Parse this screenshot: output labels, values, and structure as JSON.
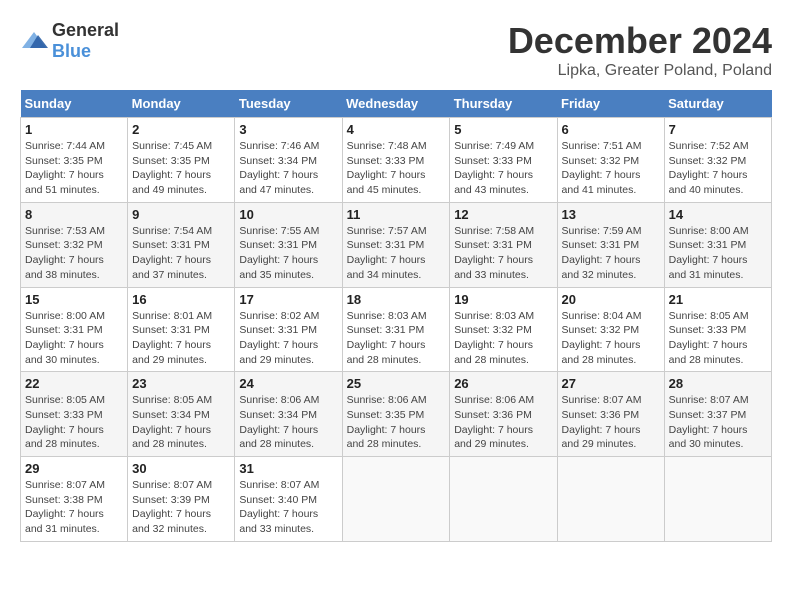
{
  "header": {
    "logo": {
      "text_general": "General",
      "text_blue": "Blue"
    },
    "title": "December 2024",
    "subtitle": "Lipka, Greater Poland, Poland"
  },
  "calendar": {
    "columns": [
      "Sunday",
      "Monday",
      "Tuesday",
      "Wednesday",
      "Thursday",
      "Friday",
      "Saturday"
    ],
    "weeks": [
      [
        null,
        {
          "day": "2",
          "sunrise": "Sunrise: 7:45 AM",
          "sunset": "Sunset: 3:35 PM",
          "daylight": "Daylight: 7 hours and 49 minutes."
        },
        {
          "day": "3",
          "sunrise": "Sunrise: 7:46 AM",
          "sunset": "Sunset: 3:34 PM",
          "daylight": "Daylight: 7 hours and 47 minutes."
        },
        {
          "day": "4",
          "sunrise": "Sunrise: 7:48 AM",
          "sunset": "Sunset: 3:33 PM",
          "daylight": "Daylight: 7 hours and 45 minutes."
        },
        {
          "day": "5",
          "sunrise": "Sunrise: 7:49 AM",
          "sunset": "Sunset: 3:33 PM",
          "daylight": "Daylight: 7 hours and 43 minutes."
        },
        {
          "day": "6",
          "sunrise": "Sunrise: 7:51 AM",
          "sunset": "Sunset: 3:32 PM",
          "daylight": "Daylight: 7 hours and 41 minutes."
        },
        {
          "day": "7",
          "sunrise": "Sunrise: 7:52 AM",
          "sunset": "Sunset: 3:32 PM",
          "daylight": "Daylight: 7 hours and 40 minutes."
        }
      ],
      [
        {
          "day": "1",
          "sunrise": "Sunrise: 7:44 AM",
          "sunset": "Sunset: 3:35 PM",
          "daylight": "Daylight: 7 hours and 51 minutes."
        },
        {
          "day": "8",
          "sunrise": "Sunrise: 7:53 AM",
          "sunset": "Sunset: 3:32 PM",
          "daylight": "Daylight: 7 hours and 38 minutes."
        },
        {
          "day": "9",
          "sunrise": "Sunrise: 7:54 AM",
          "sunset": "Sunset: 3:31 PM",
          "daylight": "Daylight: 7 hours and 37 minutes."
        },
        {
          "day": "10",
          "sunrise": "Sunrise: 7:55 AM",
          "sunset": "Sunset: 3:31 PM",
          "daylight": "Daylight: 7 hours and 35 minutes."
        },
        {
          "day": "11",
          "sunrise": "Sunrise: 7:57 AM",
          "sunset": "Sunset: 3:31 PM",
          "daylight": "Daylight: 7 hours and 34 minutes."
        },
        {
          "day": "12",
          "sunrise": "Sunrise: 7:58 AM",
          "sunset": "Sunset: 3:31 PM",
          "daylight": "Daylight: 7 hours and 33 minutes."
        },
        {
          "day": "13",
          "sunrise": "Sunrise: 7:59 AM",
          "sunset": "Sunset: 3:31 PM",
          "daylight": "Daylight: 7 hours and 32 minutes."
        },
        {
          "day": "14",
          "sunrise": "Sunrise: 8:00 AM",
          "sunset": "Sunset: 3:31 PM",
          "daylight": "Daylight: 7 hours and 31 minutes."
        }
      ],
      [
        {
          "day": "15",
          "sunrise": "Sunrise: 8:00 AM",
          "sunset": "Sunset: 3:31 PM",
          "daylight": "Daylight: 7 hours and 30 minutes."
        },
        {
          "day": "16",
          "sunrise": "Sunrise: 8:01 AM",
          "sunset": "Sunset: 3:31 PM",
          "daylight": "Daylight: 7 hours and 29 minutes."
        },
        {
          "day": "17",
          "sunrise": "Sunrise: 8:02 AM",
          "sunset": "Sunset: 3:31 PM",
          "daylight": "Daylight: 7 hours and 29 minutes."
        },
        {
          "day": "18",
          "sunrise": "Sunrise: 8:03 AM",
          "sunset": "Sunset: 3:31 PM",
          "daylight": "Daylight: 7 hours and 28 minutes."
        },
        {
          "day": "19",
          "sunrise": "Sunrise: 8:03 AM",
          "sunset": "Sunset: 3:32 PM",
          "daylight": "Daylight: 7 hours and 28 minutes."
        },
        {
          "day": "20",
          "sunrise": "Sunrise: 8:04 AM",
          "sunset": "Sunset: 3:32 PM",
          "daylight": "Daylight: 7 hours and 28 minutes."
        },
        {
          "day": "21",
          "sunrise": "Sunrise: 8:05 AM",
          "sunset": "Sunset: 3:33 PM",
          "daylight": "Daylight: 7 hours and 28 minutes."
        }
      ],
      [
        {
          "day": "22",
          "sunrise": "Sunrise: 8:05 AM",
          "sunset": "Sunset: 3:33 PM",
          "daylight": "Daylight: 7 hours and 28 minutes."
        },
        {
          "day": "23",
          "sunrise": "Sunrise: 8:05 AM",
          "sunset": "Sunset: 3:34 PM",
          "daylight": "Daylight: 7 hours and 28 minutes."
        },
        {
          "day": "24",
          "sunrise": "Sunrise: 8:06 AM",
          "sunset": "Sunset: 3:34 PM",
          "daylight": "Daylight: 7 hours and 28 minutes."
        },
        {
          "day": "25",
          "sunrise": "Sunrise: 8:06 AM",
          "sunset": "Sunset: 3:35 PM",
          "daylight": "Daylight: 7 hours and 28 minutes."
        },
        {
          "day": "26",
          "sunrise": "Sunrise: 8:06 AM",
          "sunset": "Sunset: 3:36 PM",
          "daylight": "Daylight: 7 hours and 29 minutes."
        },
        {
          "day": "27",
          "sunrise": "Sunrise: 8:07 AM",
          "sunset": "Sunset: 3:36 PM",
          "daylight": "Daylight: 7 hours and 29 minutes."
        },
        {
          "day": "28",
          "sunrise": "Sunrise: 8:07 AM",
          "sunset": "Sunset: 3:37 PM",
          "daylight": "Daylight: 7 hours and 30 minutes."
        }
      ],
      [
        {
          "day": "29",
          "sunrise": "Sunrise: 8:07 AM",
          "sunset": "Sunset: 3:38 PM",
          "daylight": "Daylight: 7 hours and 31 minutes."
        },
        {
          "day": "30",
          "sunrise": "Sunrise: 8:07 AM",
          "sunset": "Sunset: 3:39 PM",
          "daylight": "Daylight: 7 hours and 32 minutes."
        },
        {
          "day": "31",
          "sunrise": "Sunrise: 8:07 AM",
          "sunset": "Sunset: 3:40 PM",
          "daylight": "Daylight: 7 hours and 33 minutes."
        },
        null,
        null,
        null,
        null
      ]
    ]
  }
}
